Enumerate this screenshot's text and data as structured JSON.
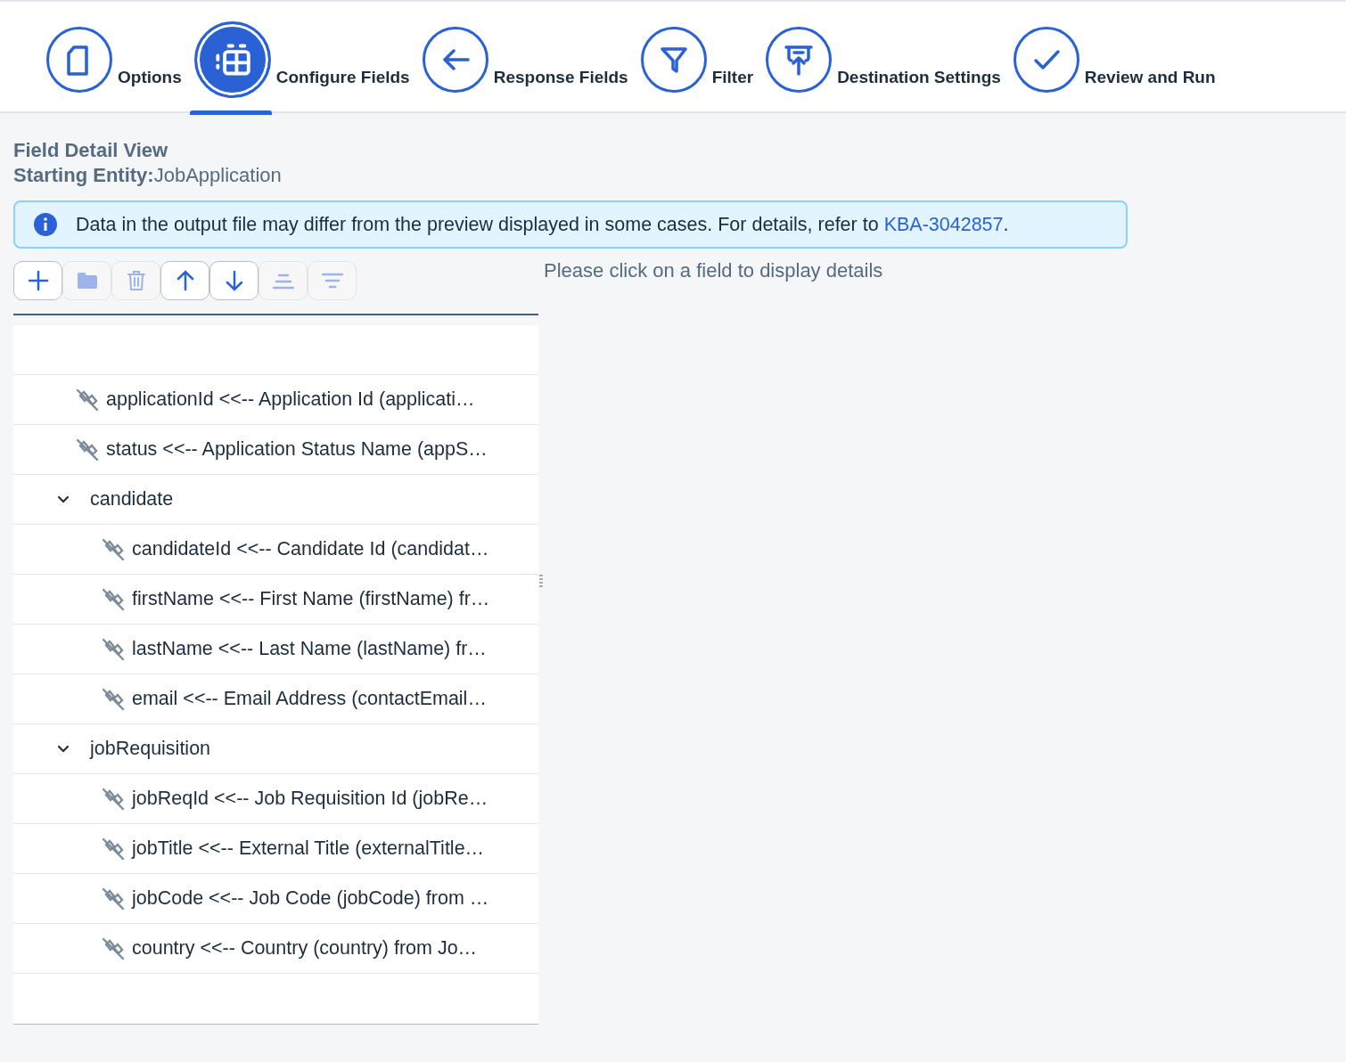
{
  "steps": [
    {
      "label": "Options",
      "selected": false
    },
    {
      "label": "Configure Fields",
      "selected": true
    },
    {
      "label": "Response Fields",
      "selected": false
    },
    {
      "label": "Filter",
      "selected": false
    },
    {
      "label": "Destination Settings",
      "selected": false
    },
    {
      "label": "Review and Run",
      "selected": false
    }
  ],
  "header": {
    "title": "Field Detail View",
    "entity_label": "Starting Entity:",
    "entity_value": "JobApplication"
  },
  "info": {
    "text": "Data in the output file may differ from the preview displayed in some cases. For details, refer to ",
    "link": "KBA-3042857",
    "after": "."
  },
  "toolbar": [
    {
      "kind": "add",
      "disabled": false
    },
    {
      "kind": "folder",
      "disabled": true
    },
    {
      "kind": "delete",
      "disabled": true
    },
    {
      "kind": "up",
      "disabled": false
    },
    {
      "kind": "down",
      "disabled": false
    },
    {
      "kind": "center",
      "disabled": true
    },
    {
      "kind": "sort",
      "disabled": true
    }
  ],
  "tree": [
    {
      "kind": "field",
      "label": "applicationId <<-- Application Id (applicati…"
    },
    {
      "kind": "field",
      "label": "status <<-- Application Status Name (appS…"
    },
    {
      "kind": "group",
      "label": "candidate",
      "expanded": true,
      "children": [
        {
          "kind": "field",
          "label": "candidateId <<-- Candidate Id (candidat…"
        },
        {
          "kind": "field",
          "label": "firstName <<-- First Name (firstName) fr…"
        },
        {
          "kind": "field",
          "label": "lastName <<-- Last Name (lastName) fr…"
        },
        {
          "kind": "field",
          "label": "email <<-- Email Address (contactEmail…"
        }
      ]
    },
    {
      "kind": "group",
      "label": "jobRequisition",
      "expanded": true,
      "children": [
        {
          "kind": "field",
          "label": "jobReqId <<-- Job Requisition Id (jobRe…"
        },
        {
          "kind": "field",
          "label": "jobTitle <<-- External Title (externalTitle…"
        },
        {
          "kind": "field",
          "label": "jobCode <<-- Job Code (jobCode) from …"
        },
        {
          "kind": "field",
          "label": "country <<-- Country (country) from Jo…"
        }
      ]
    }
  ],
  "detail_hint": "Please click on a field to display details"
}
